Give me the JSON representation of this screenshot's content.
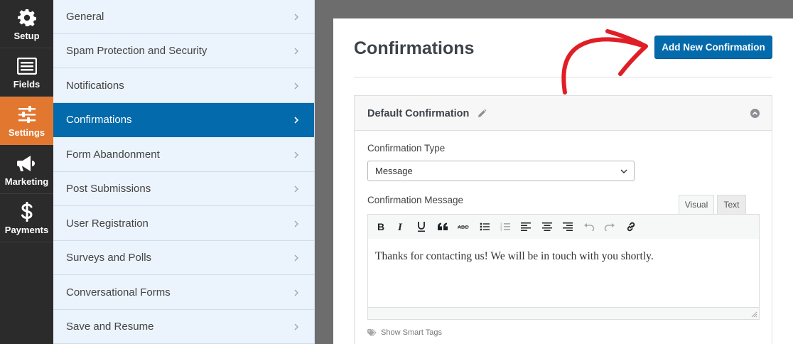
{
  "rail": [
    {
      "label": "Setup",
      "icon": "gear-icon"
    },
    {
      "label": "Fields",
      "icon": "fields-icon"
    },
    {
      "label": "Settings",
      "icon": "sliders-icon"
    },
    {
      "label": "Marketing",
      "icon": "megaphone-icon"
    },
    {
      "label": "Payments",
      "icon": "dollar-icon"
    }
  ],
  "submenu": [
    {
      "label": "General"
    },
    {
      "label": "Spam Protection and Security"
    },
    {
      "label": "Notifications"
    },
    {
      "label": "Confirmations"
    },
    {
      "label": "Form Abandonment"
    },
    {
      "label": "Post Submissions"
    },
    {
      "label": "User Registration"
    },
    {
      "label": "Surveys and Polls"
    },
    {
      "label": "Conversational Forms"
    },
    {
      "label": "Save and Resume"
    }
  ],
  "panel": {
    "title": "Confirmations",
    "add_button": "Add New Confirmation",
    "confirmation": {
      "name": "Default Confirmation",
      "type_label": "Confirmation Type",
      "type_value": "Message",
      "message_label": "Confirmation Message",
      "tab_visual": "Visual",
      "tab_text": "Text",
      "message_text": "Thanks for contacting us! We will be in touch with you shortly.",
      "smart_tags": "Show Smart Tags"
    }
  },
  "colors": {
    "accent_orange": "#e27730",
    "accent_blue": "#036aab",
    "arrow_red": "#e01e26",
    "rail_bg": "#2b2b2b",
    "submenu_bg": "#ebf3fc"
  }
}
